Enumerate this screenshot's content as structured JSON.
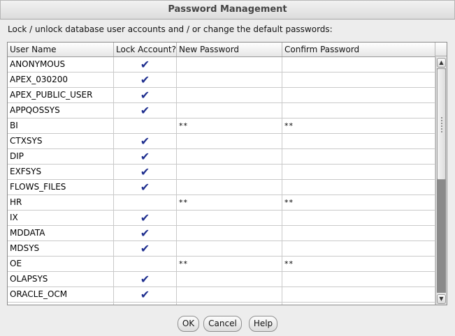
{
  "window": {
    "title": "Password Management"
  },
  "instruction": "Lock / unlock database user accounts and / or change the default passwords:",
  "table": {
    "columns": [
      "User Name",
      "Lock Account?",
      "New Password",
      "Confirm Password"
    ],
    "check_glyph": "✔",
    "rows": [
      {
        "user": "ANONYMOUS",
        "locked": true,
        "new_password": "",
        "confirm_password": ""
      },
      {
        "user": "APEX_030200",
        "locked": true,
        "new_password": "",
        "confirm_password": ""
      },
      {
        "user": "APEX_PUBLIC_USER",
        "locked": true,
        "new_password": "",
        "confirm_password": ""
      },
      {
        "user": "APPQOSSYS",
        "locked": true,
        "new_password": "",
        "confirm_password": ""
      },
      {
        "user": "BI",
        "locked": false,
        "new_password": "**",
        "confirm_password": "**"
      },
      {
        "user": "CTXSYS",
        "locked": true,
        "new_password": "",
        "confirm_password": ""
      },
      {
        "user": "DIP",
        "locked": true,
        "new_password": "",
        "confirm_password": ""
      },
      {
        "user": "EXFSYS",
        "locked": true,
        "new_password": "",
        "confirm_password": ""
      },
      {
        "user": "FLOWS_FILES",
        "locked": true,
        "new_password": "",
        "confirm_password": ""
      },
      {
        "user": "HR",
        "locked": false,
        "new_password": "**",
        "confirm_password": "**"
      },
      {
        "user": "IX",
        "locked": true,
        "new_password": "",
        "confirm_password": ""
      },
      {
        "user": "MDDATA",
        "locked": true,
        "new_password": "",
        "confirm_password": ""
      },
      {
        "user": "MDSYS",
        "locked": true,
        "new_password": "",
        "confirm_password": ""
      },
      {
        "user": "OE",
        "locked": false,
        "new_password": "**",
        "confirm_password": "**"
      },
      {
        "user": "OLAPSYS",
        "locked": true,
        "new_password": "",
        "confirm_password": ""
      },
      {
        "user": "ORACLE_OCM",
        "locked": true,
        "new_password": "",
        "confirm_password": ""
      },
      {
        "user": "",
        "locked": false,
        "new_password": "",
        "confirm_password": ""
      }
    ]
  },
  "scrollbar": {
    "up_glyph": "▲",
    "down_glyph": "▼"
  },
  "buttons": {
    "ok": "OK",
    "cancel": "Cancel",
    "help": "Help"
  },
  "colors": {
    "check": "#1f2f8f",
    "window_bg": "#ededed"
  }
}
